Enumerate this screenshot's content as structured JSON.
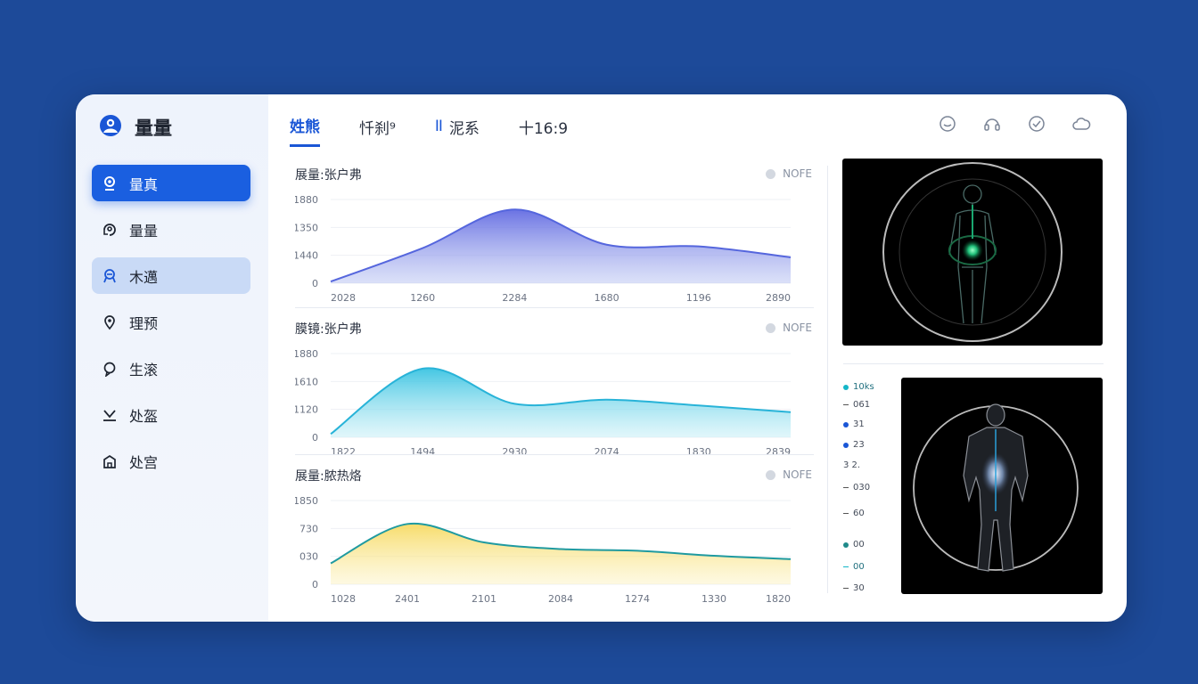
{
  "app": {
    "title": "量量"
  },
  "sidebar": {
    "items": [
      {
        "label": "量真",
        "icon": "user-pin-icon",
        "state": "active"
      },
      {
        "label": "量量",
        "icon": "refresh-person-icon",
        "state": "normal"
      },
      {
        "label": "木邁",
        "icon": "user-badge-icon",
        "state": "selected"
      },
      {
        "label": "理预",
        "icon": "location-pin-icon",
        "state": "normal"
      },
      {
        "label": "生滚",
        "icon": "chat-bubble-icon",
        "state": "normal"
      },
      {
        "label": "处盔",
        "icon": "chevron-down-bar-icon",
        "state": "normal"
      },
      {
        "label": "处宫",
        "icon": "building-icon",
        "state": "normal"
      }
    ]
  },
  "tabs": [
    {
      "label": "姓熊",
      "active": true
    },
    {
      "label": "忏刹⁹",
      "active": false
    },
    {
      "label": "泥系",
      "active": false,
      "marker": "II"
    },
    {
      "label": "十16:9",
      "active": false
    }
  ],
  "top_icons": [
    "smile-icon",
    "headset-icon",
    "check-circle-icon",
    "cloud-icon"
  ],
  "panels": [
    {
      "title": "展量:张户弗",
      "note": "NOFE"
    },
    {
      "title": "膜镜:张户弗",
      "note": "NOFE"
    },
    {
      "title": "展量:脓热烙",
      "note": "NOFE"
    }
  ],
  "chart_data": [
    {
      "type": "area",
      "title": "展量:张户弗",
      "x": [
        "2028",
        "1260",
        "2284",
        "1680",
        "1196",
        "2890"
      ],
      "y_ticks": [
        "1880",
        "1350",
        "1440",
        "0"
      ],
      "series": [
        {
          "values": [
            2,
            42,
            88,
            46,
            44,
            31
          ]
        }
      ],
      "ylim": [
        0,
        100
      ],
      "color": "#5566dd"
    },
    {
      "type": "area",
      "title": "膜镜:张户弗",
      "x": [
        "1822",
        "1494",
        "2930",
        "2074",
        "1830",
        "2839"
      ],
      "y_ticks": [
        "1880",
        "1610",
        "1120",
        "0"
      ],
      "series": [
        {
          "values": [
            4,
            82,
            40,
            45,
            38,
            30
          ]
        }
      ],
      "ylim": [
        0,
        100
      ],
      "color": "#28b3d8"
    },
    {
      "type": "area",
      "title": "展量:脓热烙",
      "x": [
        "1028",
        "2401",
        "2101",
        "2084",
        "1274",
        "1330",
        "1820"
      ],
      "y_ticks": [
        "1850",
        "730",
        "030",
        "0"
      ],
      "series": [
        {
          "values": [
            25,
            72,
            50,
            42,
            40,
            34,
            30
          ]
        }
      ],
      "ylim": [
        0,
        100
      ],
      "color": "#1f9aa0"
    }
  ],
  "legend": [
    {
      "label": "10ks",
      "marker": "dot",
      "color": "#14b6c8"
    },
    {
      "label": "061",
      "marker": "dash",
      "color": "#555555"
    },
    {
      "label": "31",
      "marker": "dot",
      "color": "#1a56d6"
    },
    {
      "label": "23",
      "marker": "dot",
      "color": "#1a56d6"
    },
    {
      "label": "3 2.",
      "marker": "none",
      "color": "#555555"
    },
    {
      "label": "030",
      "marker": "dash",
      "color": "#555555"
    },
    {
      "label": "60",
      "marker": "dash",
      "color": "#555555"
    },
    {
      "label": "00",
      "marker": "dot",
      "color": "#1f8a8a"
    },
    {
      "label": "00",
      "marker": "dash",
      "color": "#14b6c8"
    },
    {
      "label": "30",
      "marker": "dash",
      "color": "#555555"
    }
  ]
}
